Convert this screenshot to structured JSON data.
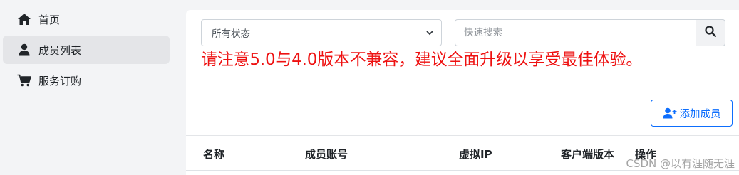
{
  "sidebar": {
    "items": [
      {
        "label": "首页",
        "icon": "home-icon",
        "active": false
      },
      {
        "label": "成员列表",
        "icon": "user-icon",
        "active": true
      },
      {
        "label": "服务订购",
        "icon": "cart-icon",
        "active": false
      }
    ]
  },
  "filters": {
    "status_selected": "所有状态",
    "search_placeholder": "快速搜索",
    "search_icon": "search-icon"
  },
  "notice": {
    "text": "请注意5.0与4.0版本不兼容，建议全面升级以享受最佳体验。",
    "color": "#ee1111"
  },
  "actions": {
    "add_member_label": "添加成员",
    "add_member_icon": "user-plus-icon",
    "accent_color": "#0d6efd"
  },
  "table": {
    "columns": [
      "名称",
      "成员账号",
      "虚拟IP",
      "客户端版本",
      "操作"
    ]
  },
  "watermark": "CSDN @以有涯随无涯"
}
